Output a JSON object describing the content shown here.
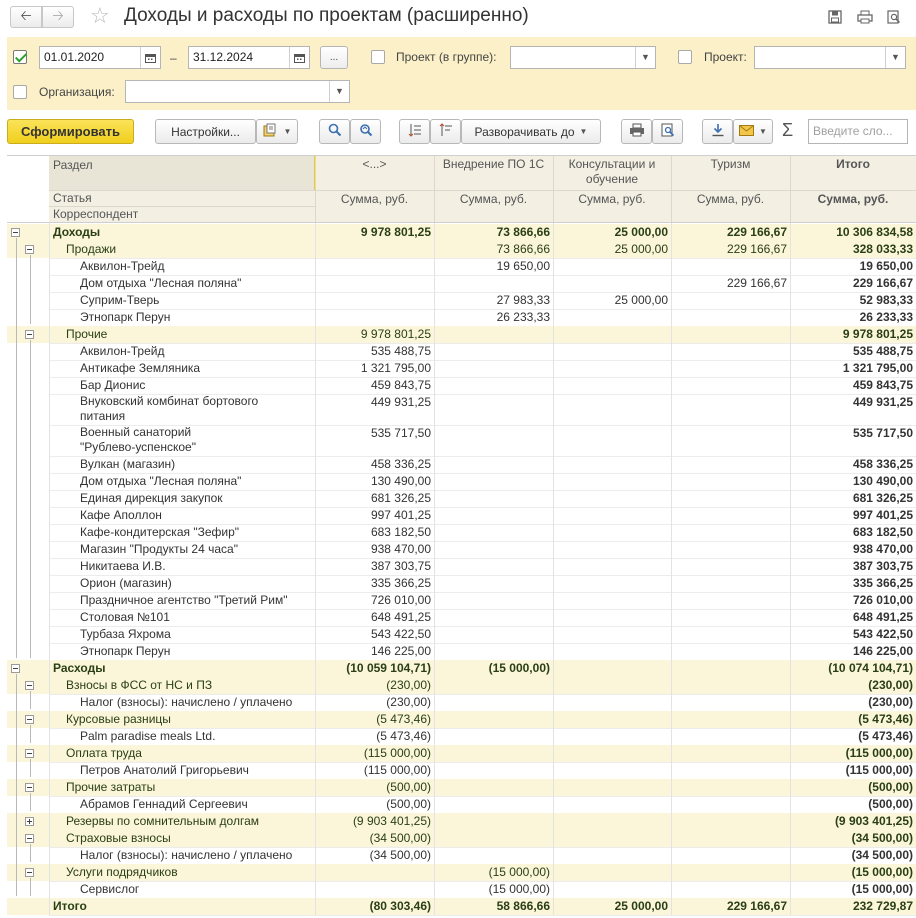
{
  "window": {
    "title": "Доходы и расходы по проектам (расширенно)"
  },
  "filters": {
    "period_from": "01.01.2020",
    "period_to": "31.12.2024",
    "dash": "–",
    "more": "...",
    "project_group_label": "Проект (в группе):",
    "project_label": "Проект:",
    "organization_label": "Организация:",
    "project_group_value": "",
    "project_value": "",
    "organization_value": ""
  },
  "toolbar": {
    "generate": "Сформировать",
    "settings": "Настройки...",
    "expand_to": "Разворачивать до",
    "search_placeholder": "Введите сло..."
  },
  "report": {
    "header": {
      "razdel": "Раздел",
      "statya": "Статья",
      "korrespondent": "Корреспондент",
      "columns": [
        "<...>",
        "Внедрение ПО 1С",
        "Консультации и обучение",
        "Туризм",
        "Итого"
      ],
      "sum_label": "Сумма, руб."
    },
    "rows": [
      {
        "label": "Доходы",
        "level": 0,
        "group": true,
        "toggle": "minus",
        "v": [
          "9 978 801,25",
          "73 866,66",
          "25 000,00",
          "229 166,67",
          "10 306 834,58"
        ]
      },
      {
        "label": "Продажи",
        "level": 1,
        "group": true,
        "toggle": "minus",
        "v": [
          "",
          "73 866,66",
          "25 000,00",
          "229 166,67",
          "328 033,33"
        ]
      },
      {
        "label": "Аквилон-Трейд",
        "level": 2,
        "v": [
          "",
          "19 650,00",
          "",
          "",
          "19 650,00"
        ]
      },
      {
        "label": "Дом отдыха \"Лесная поляна\"",
        "level": 2,
        "v": [
          "",
          "",
          "",
          "229 166,67",
          "229 166,67"
        ]
      },
      {
        "label": "Суприм-Тверь",
        "level": 2,
        "v": [
          "",
          "27 983,33",
          "25 000,00",
          "",
          "52 983,33"
        ]
      },
      {
        "label": "Этнопарк Перун",
        "level": 2,
        "v": [
          "",
          "26 233,33",
          "",
          "",
          "26 233,33"
        ]
      },
      {
        "label": "Прочие",
        "level": 1,
        "group": true,
        "toggle": "minus",
        "v": [
          "9 978 801,25",
          "",
          "",
          "",
          "9 978 801,25"
        ]
      },
      {
        "label": "Аквилон-Трейд",
        "level": 2,
        "v": [
          "535 488,75",
          "",
          "",
          "",
          "535 488,75"
        ]
      },
      {
        "label": "Антикафе Земляника",
        "level": 2,
        "v": [
          "1 321 795,00",
          "",
          "",
          "",
          "1 321 795,00"
        ]
      },
      {
        "label": "Бар Дионис",
        "level": 2,
        "v": [
          "459 843,75",
          "",
          "",
          "",
          "459 843,75"
        ]
      },
      {
        "label": "Внуковский комбинат бортового питания",
        "level": 2,
        "lines": [
          "Внуковский комбинат бортового",
          "питания"
        ],
        "v": [
          "449 931,25",
          "",
          "",
          "",
          "449 931,25"
        ]
      },
      {
        "label": "Военный санаторий \"Рублево-успенское\"",
        "level": 2,
        "lines": [
          "Военный санаторий",
          "\"Рублево-успенское\""
        ],
        "v": [
          "535 717,50",
          "",
          "",
          "",
          "535 717,50"
        ]
      },
      {
        "label": "Вулкан (магазин)",
        "level": 2,
        "v": [
          "458 336,25",
          "",
          "",
          "",
          "458 336,25"
        ]
      },
      {
        "label": "Дом отдыха \"Лесная поляна\"",
        "level": 2,
        "v": [
          "130 490,00",
          "",
          "",
          "",
          "130 490,00"
        ]
      },
      {
        "label": "Единая дирекция закупок",
        "level": 2,
        "v": [
          "681 326,25",
          "",
          "",
          "",
          "681 326,25"
        ]
      },
      {
        "label": "Кафе Аполлон",
        "level": 2,
        "v": [
          "997 401,25",
          "",
          "",
          "",
          "997 401,25"
        ]
      },
      {
        "label": "Кафе-кондитерская \"Зефир\"",
        "level": 2,
        "v": [
          "683 182,50",
          "",
          "",
          "",
          "683 182,50"
        ]
      },
      {
        "label": "Магазин \"Продукты 24 часа\"",
        "level": 2,
        "v": [
          "938 470,00",
          "",
          "",
          "",
          "938 470,00"
        ]
      },
      {
        "label": "Никитаева И.В.",
        "level": 2,
        "v": [
          "387 303,75",
          "",
          "",
          "",
          "387 303,75"
        ]
      },
      {
        "label": "Орион (магазин)",
        "level": 2,
        "v": [
          "335 366,25",
          "",
          "",
          "",
          "335 366,25"
        ]
      },
      {
        "label": "Праздничное агентство \"Третий Рим\"",
        "level": 2,
        "v": [
          "726 010,00",
          "",
          "",
          "",
          "726 010,00"
        ]
      },
      {
        "label": "Столовая №101",
        "level": 2,
        "v": [
          "648 491,25",
          "",
          "",
          "",
          "648 491,25"
        ]
      },
      {
        "label": "Турбаза Яхрома",
        "level": 2,
        "v": [
          "543 422,50",
          "",
          "",
          "",
          "543 422,50"
        ]
      },
      {
        "label": "Этнопарк Перун",
        "level": 2,
        "v": [
          "146 225,00",
          "",
          "",
          "",
          "146 225,00"
        ]
      },
      {
        "label": "Расходы",
        "level": 0,
        "group": true,
        "toggle": "minus",
        "v": [
          "(10 059 104,71)",
          "(15 000,00)",
          "",
          "",
          "(10 074 104,71)"
        ]
      },
      {
        "label": "Взносы в ФСС от НС и ПЗ",
        "level": 1,
        "group": true,
        "toggle": "minus",
        "v": [
          "(230,00)",
          "",
          "",
          "",
          "(230,00)"
        ]
      },
      {
        "label": "Налог (взносы): начислено / уплачено",
        "level": 2,
        "v": [
          "(230,00)",
          "",
          "",
          "",
          "(230,00)"
        ]
      },
      {
        "label": "Курсовые разницы",
        "level": 1,
        "group": true,
        "toggle": "minus",
        "v": [
          "(5 473,46)",
          "",
          "",
          "",
          "(5 473,46)"
        ]
      },
      {
        "label": "Palm paradise meals Ltd.",
        "level": 2,
        "v": [
          "(5 473,46)",
          "",
          "",
          "",
          "(5 473,46)"
        ]
      },
      {
        "label": "Оплата труда",
        "level": 1,
        "group": true,
        "toggle": "minus",
        "v": [
          "(115 000,00)",
          "",
          "",
          "",
          "(115 000,00)"
        ]
      },
      {
        "label": "Петров Анатолий Григорьевич",
        "level": 2,
        "v": [
          "(115 000,00)",
          "",
          "",
          "",
          "(115 000,00)"
        ]
      },
      {
        "label": "Прочие затраты",
        "level": 1,
        "group": true,
        "toggle": "minus",
        "v": [
          "(500,00)",
          "",
          "",
          "",
          "(500,00)"
        ]
      },
      {
        "label": "Абрамов Геннадий Сергеевич",
        "level": 2,
        "v": [
          "(500,00)",
          "",
          "",
          "",
          "(500,00)"
        ]
      },
      {
        "label": "Резервы по сомнительным долгам",
        "level": 1,
        "group": true,
        "toggle": "plus",
        "v": [
          "(9 903 401,25)",
          "",
          "",
          "",
          "(9 903 401,25)"
        ]
      },
      {
        "label": "Страховые взносы",
        "level": 1,
        "group": true,
        "toggle": "minus",
        "v": [
          "(34 500,00)",
          "",
          "",
          "",
          "(34 500,00)"
        ]
      },
      {
        "label": "Налог (взносы): начислено / уплачено",
        "level": 2,
        "v": [
          "(34 500,00)",
          "",
          "",
          "",
          "(34 500,00)"
        ]
      },
      {
        "label": "Услуги подрядчиков",
        "level": 1,
        "group": true,
        "toggle": "minus",
        "v": [
          "",
          "(15 000,00)",
          "",
          "",
          "(15 000,00)"
        ]
      },
      {
        "label": "Сервислог",
        "level": 2,
        "v": [
          "",
          "(15 000,00)",
          "",
          "",
          "(15 000,00)"
        ]
      },
      {
        "label": "Итого",
        "level": 0,
        "group": true,
        "total": true,
        "v": [
          "(80 303,46)",
          "58 866,66",
          "25 000,00",
          "229 166,67",
          "232 729,87"
        ]
      }
    ]
  }
}
